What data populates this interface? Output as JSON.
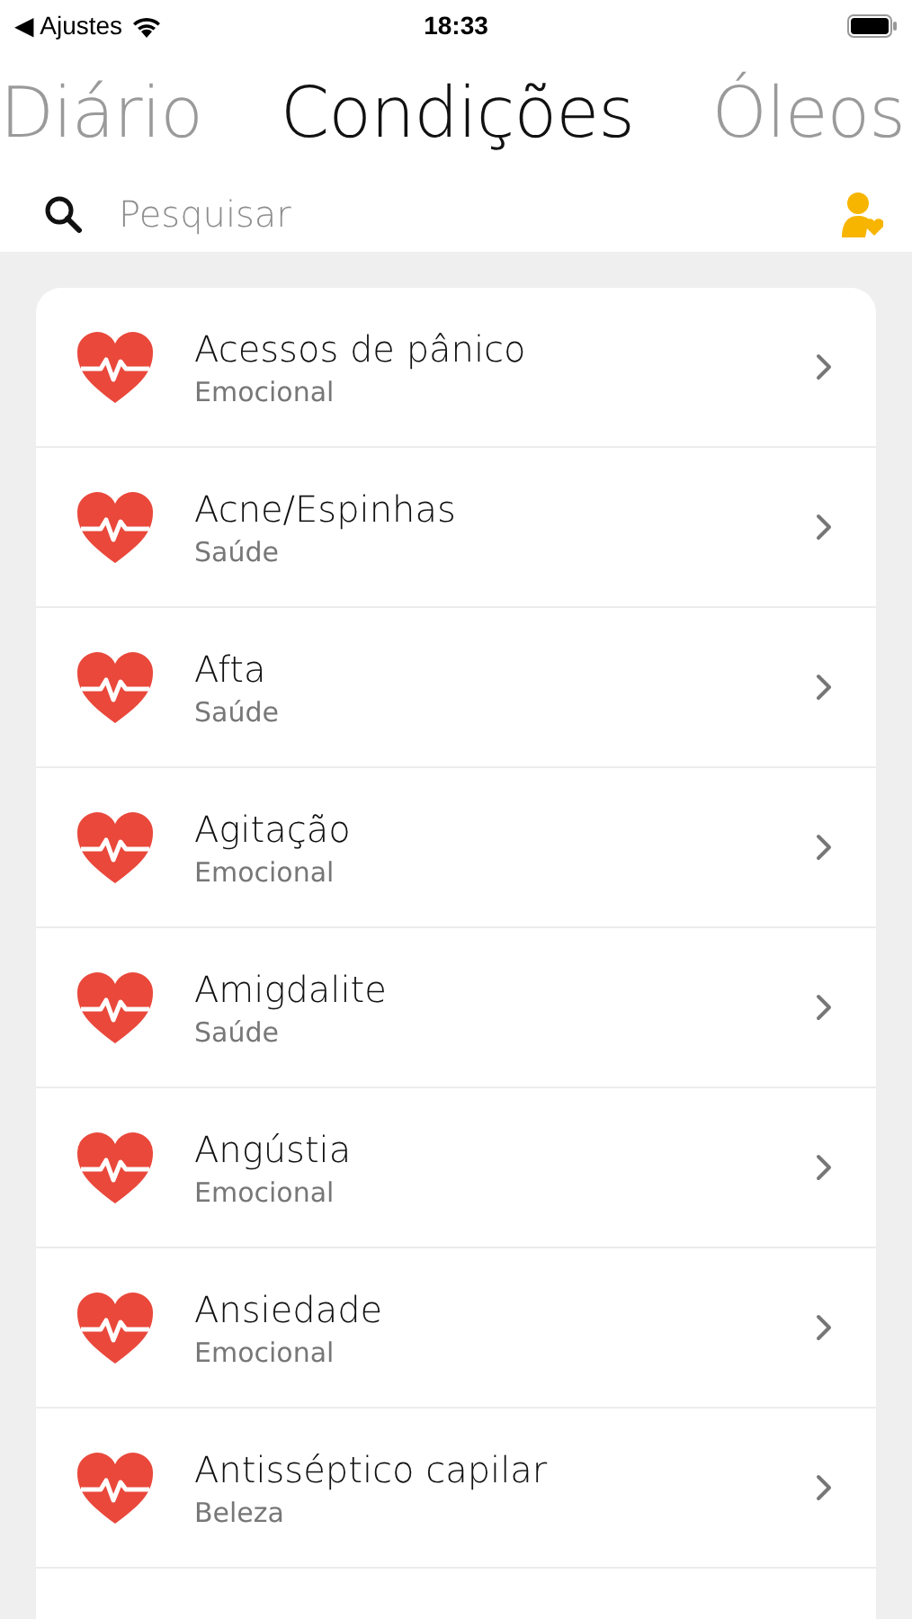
{
  "status_bar": {
    "back_label": "◀ Ajustes",
    "time": "18:33"
  },
  "tabs": [
    {
      "label": "Diário",
      "selected": false
    },
    {
      "label": "Condições",
      "selected": true
    },
    {
      "label": "Óleos",
      "selected": false
    }
  ],
  "search": {
    "placeholder": "Pesquisar"
  },
  "conditions": [
    {
      "name": "Acessos de pânico",
      "category": "Emocional"
    },
    {
      "name": "Acne/Espinhas",
      "category": "Saúde"
    },
    {
      "name": "Afta",
      "category": "Saúde"
    },
    {
      "name": "Agitação",
      "category": "Emocional"
    },
    {
      "name": "Amigdalite",
      "category": "Saúde"
    },
    {
      "name": "Angústia",
      "category": "Emocional"
    },
    {
      "name": "Ansiedade",
      "category": "Emocional"
    },
    {
      "name": "Antisséptico capilar",
      "category": "Beleza"
    }
  ]
}
